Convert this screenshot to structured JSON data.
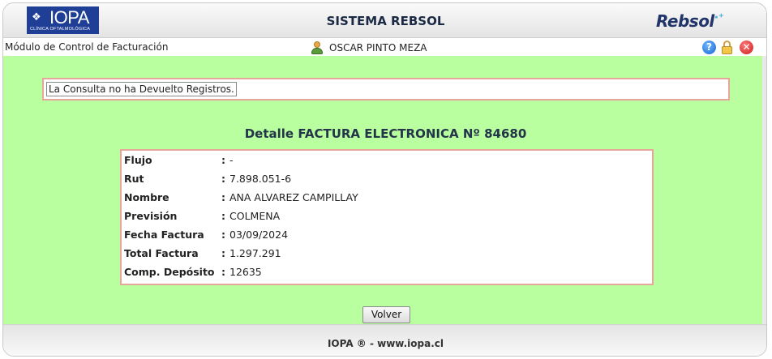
{
  "header": {
    "logo_left": {
      "name": "IOPA",
      "subtitle": "CLÍNICA OFTALMOLÓGICA"
    },
    "title": "SISTEMA REBSOL",
    "logo_right": "Rebsol"
  },
  "infobar": {
    "module": "Módulo de Control de Facturación",
    "user": "OSCAR PINTO MEZA",
    "icons": [
      "user-icon",
      "help-icon",
      "lock-icon",
      "close-icon"
    ]
  },
  "message": "La Consulta no ha Devuelto Registros.",
  "detail": {
    "title": "Detalle FACTURA ELECTRONICA Nº 84680",
    "rows": [
      {
        "label": "Flujo",
        "value": "-"
      },
      {
        "label": "Rut",
        "value": "7.898.051-6"
      },
      {
        "label": "Nombre",
        "value": "ANA ALVAREZ CAMPILLAY"
      },
      {
        "label": "Previsión",
        "value": "COLMENA"
      },
      {
        "label": "Fecha Factura",
        "value": "03/09/2024"
      },
      {
        "label": "Total Factura",
        "value": "1.297.291"
      },
      {
        "label": "Comp. Depósito",
        "value": "12635"
      }
    ],
    "colon": ":"
  },
  "buttons": {
    "back": "Volver"
  },
  "footer": "IOPA ® - www.iopa.cl",
  "colors": {
    "main_bg": "#b9ff9f",
    "box_border": "#e6a69a",
    "brand_blue": "#1f3e96"
  }
}
